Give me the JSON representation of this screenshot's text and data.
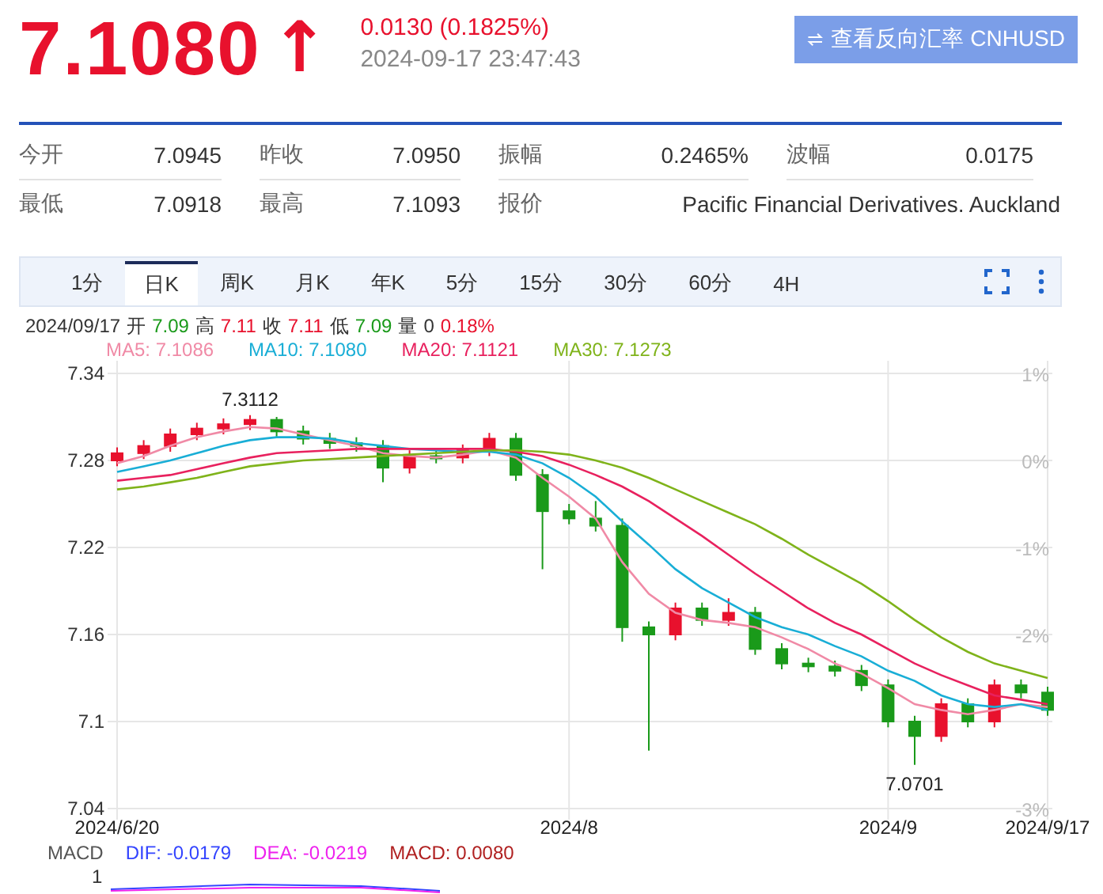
{
  "quote": {
    "price": "7.1080",
    "arrow": "↑",
    "change": "0.0130 (0.1825%)",
    "time": "2024-09-17 23:47:43",
    "reverse_button": "查看反向汇率 CNHUSD"
  },
  "stats": [
    [
      {
        "label": "今开",
        "value": "7.0945"
      },
      {
        "label": "昨收",
        "value": "7.0950"
      },
      {
        "label": "振幅",
        "value": "0.2465%"
      },
      {
        "label": "波幅",
        "value": "0.0175"
      }
    ],
    [
      {
        "label": "最低",
        "value": "7.0918"
      },
      {
        "label": "最高",
        "value": "7.1093"
      },
      {
        "label": "报价",
        "value": "Pacific Financial Derivatives. Auckland"
      }
    ]
  ],
  "tabs": [
    {
      "label": "1分",
      "selected": false
    },
    {
      "label": "日K",
      "selected": true
    },
    {
      "label": "周K",
      "selected": false
    },
    {
      "label": "月K",
      "selected": false
    },
    {
      "label": "年K",
      "selected": false
    },
    {
      "label": "5分",
      "selected": false
    },
    {
      "label": "15分",
      "selected": false
    },
    {
      "label": "30分",
      "selected": false
    },
    {
      "label": "60分",
      "selected": false
    },
    {
      "label": "4H",
      "selected": false
    }
  ],
  "ohlc": {
    "date": "2024/09/17",
    "items": [
      {
        "label": "开",
        "value": "7.09",
        "color": "#1a9a1a"
      },
      {
        "label": "高",
        "value": "7.11",
        "color": "#e8112d"
      },
      {
        "label": "收",
        "value": "7.11",
        "color": "#e8112d"
      },
      {
        "label": "低",
        "value": "7.09",
        "color": "#1a9a1a"
      },
      {
        "label": "量",
        "value": "0",
        "color": "#333333"
      }
    ],
    "change": "0.18%"
  },
  "percent_axis": [
    "1%",
    "0%",
    "-1%",
    "-2%",
    "-3%"
  ],
  "chart_data": {
    "type": "candlestick",
    "grid": true,
    "ohlc": [
      [
        7.28,
        7.289,
        7.276,
        7.285
      ],
      [
        7.285,
        7.294,
        7.281,
        7.29
      ],
      [
        7.29,
        7.302,
        7.286,
        7.298
      ],
      [
        7.298,
        7.306,
        7.294,
        7.302
      ],
      [
        7.302,
        7.309,
        7.298,
        7.305
      ],
      [
        7.305,
        7.3112,
        7.301,
        7.308
      ],
      [
        7.308,
        7.31,
        7.296,
        7.3
      ],
      [
        7.3,
        7.304,
        7.291,
        7.295
      ],
      [
        7.295,
        7.299,
        7.288,
        7.292
      ],
      [
        7.292,
        7.296,
        7.286,
        7.29
      ],
      [
        7.29,
        7.294,
        7.265,
        7.275
      ],
      [
        7.275,
        7.287,
        7.271,
        7.283
      ],
      [
        7.283,
        7.287,
        7.278,
        7.282
      ],
      [
        7.282,
        7.291,
        7.278,
        7.287
      ],
      [
        7.287,
        7.299,
        7.283,
        7.295
      ],
      [
        7.295,
        7.299,
        7.266,
        7.27
      ],
      [
        7.27,
        7.274,
        7.205,
        7.245
      ],
      [
        7.245,
        7.25,
        7.236,
        7.24
      ],
      [
        7.24,
        7.252,
        7.231,
        7.235
      ],
      [
        7.235,
        7.24,
        7.155,
        7.165
      ],
      [
        7.165,
        7.169,
        7.08,
        7.16
      ],
      [
        7.16,
        7.182,
        7.156,
        7.178
      ],
      [
        7.178,
        7.182,
        7.166,
        7.17
      ],
      [
        7.17,
        7.185,
        7.166,
        7.175
      ],
      [
        7.175,
        7.179,
        7.146,
        7.15
      ],
      [
        7.15,
        7.154,
        7.136,
        7.14
      ],
      [
        7.14,
        7.144,
        7.134,
        7.138
      ],
      [
        7.138,
        7.142,
        7.131,
        7.135
      ],
      [
        7.135,
        7.139,
        7.121,
        7.125
      ],
      [
        7.125,
        7.129,
        7.096,
        7.1
      ],
      [
        7.1,
        7.104,
        7.0701,
        7.09
      ],
      [
        7.09,
        7.116,
        7.086,
        7.112
      ],
      [
        7.112,
        7.116,
        7.096,
        7.1
      ],
      [
        7.1,
        7.129,
        7.096,
        7.125
      ],
      [
        7.125,
        7.129,
        7.116,
        7.12
      ],
      [
        7.12,
        7.124,
        7.104,
        7.108
      ]
    ],
    "ylim": [
      7.04,
      7.34
    ],
    "yticks": [
      7.34,
      7.28,
      7.22,
      7.16,
      {
        "value": 7.1,
        "label": "7.1"
      },
      7.04
    ],
    "categories": [
      "2024/6/20",
      null,
      null,
      null,
      null,
      null,
      null,
      null,
      null,
      null,
      null,
      null,
      null,
      null,
      null,
      null,
      null,
      "2024/8",
      null,
      null,
      null,
      null,
      null,
      null,
      null,
      null,
      null,
      null,
      null,
      "2024/9",
      null,
      null,
      null,
      null,
      null,
      "2024/9/17"
    ],
    "annotations": [
      "7.3112",
      "7.0701"
    ],
    "series": [
      {
        "name": "MA5: 7.1086",
        "type": "line",
        "color": "#f08aa6",
        "values": [
          7.278,
          7.283,
          7.29,
          7.296,
          7.3,
          7.303,
          7.302,
          7.298,
          7.294,
          7.29,
          7.285,
          7.283,
          7.282,
          7.284,
          7.287,
          7.282,
          7.268,
          7.255,
          7.24,
          7.21,
          7.188,
          7.175,
          7.17,
          7.168,
          7.165,
          7.158,
          7.15,
          7.14,
          7.133,
          7.123,
          7.112,
          7.108,
          7.105,
          7.108,
          7.112,
          7.11
        ]
      },
      {
        "name": "MA10: 7.1080",
        "type": "line",
        "color": "#19aed6",
        "values": [
          7.272,
          7.276,
          7.28,
          7.285,
          7.29,
          7.294,
          7.296,
          7.296,
          7.295,
          7.292,
          7.29,
          7.288,
          7.287,
          7.286,
          7.286,
          7.284,
          7.278,
          7.268,
          7.255,
          7.238,
          7.222,
          7.205,
          7.192,
          7.182,
          7.172,
          7.165,
          7.16,
          7.152,
          7.145,
          7.135,
          7.128,
          7.118,
          7.112,
          7.11,
          7.112,
          7.108
        ]
      },
      {
        "name": "MA20: 7.1121",
        "type": "line",
        "color": "#e8215e",
        "values": [
          7.266,
          7.268,
          7.27,
          7.274,
          7.278,
          7.282,
          7.285,
          7.286,
          7.287,
          7.288,
          7.288,
          7.288,
          7.288,
          7.288,
          7.288,
          7.286,
          7.283,
          7.277,
          7.27,
          7.262,
          7.252,
          7.24,
          7.228,
          7.215,
          7.202,
          7.19,
          7.178,
          7.168,
          7.16,
          7.15,
          7.14,
          7.132,
          7.125,
          7.118,
          7.115,
          7.112
        ]
      },
      {
        "name": "MA30: 7.1273",
        "type": "line",
        "color": "#7fb31a",
        "values": [
          7.26,
          7.262,
          7.265,
          7.268,
          7.272,
          7.276,
          7.278,
          7.28,
          7.281,
          7.282,
          7.283,
          7.284,
          7.285,
          7.286,
          7.287,
          7.287,
          7.286,
          7.284,
          7.28,
          7.275,
          7.268,
          7.26,
          7.252,
          7.244,
          7.236,
          7.226,
          7.215,
          7.205,
          7.195,
          7.183,
          7.17,
          7.158,
          7.148,
          7.14,
          7.135,
          7.13
        ]
      }
    ]
  },
  "macd": {
    "label": "MACD",
    "items": [
      {
        "text": "DIF: -0.0179",
        "color": "#3344ff"
      },
      {
        "text": "DEA: -0.0219",
        "color": "#ee22ee"
      },
      {
        "text": "MACD: 0.0080",
        "color": "#b02020"
      }
    ],
    "tick": "1"
  }
}
